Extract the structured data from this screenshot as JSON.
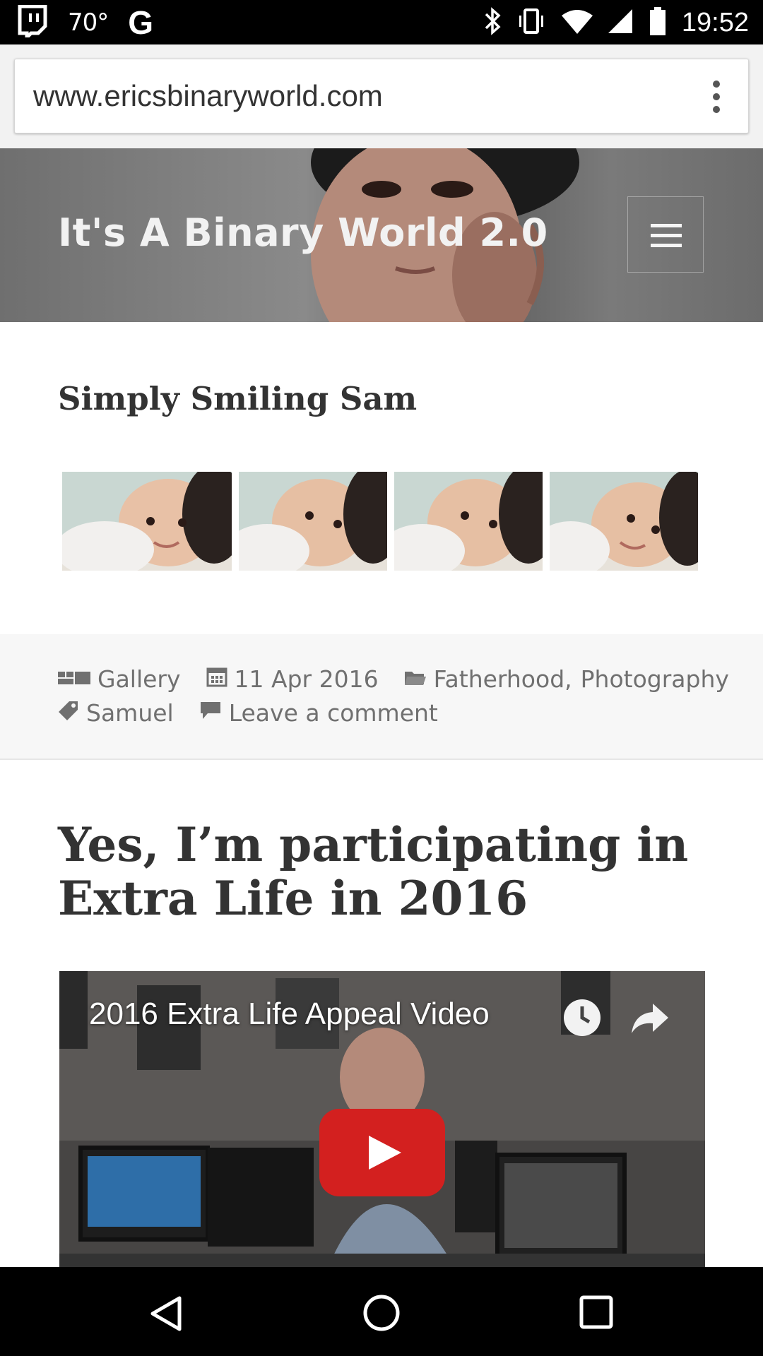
{
  "status_bar": {
    "temperature": "70°",
    "g_label": "G",
    "time": "19:52"
  },
  "browser": {
    "url": "www.ericsbinaryworld.com"
  },
  "site": {
    "title": "It's A Binary World 2.0"
  },
  "post1": {
    "title": "Simply Smiling Sam",
    "gallery_count": 4,
    "meta": {
      "format": "Gallery",
      "date": "11 Apr 2016",
      "category_1": "Fatherhood",
      "category_sep": ",",
      "category_2": "Photography",
      "tag": "Samuel",
      "comment_link": "Leave a comment"
    }
  },
  "post2": {
    "title": "Yes, I’m participating in Extra Life in 2016",
    "video_title": "2016 Extra Life Appeal Video"
  },
  "colors": {
    "status_bar_bg": "#000000",
    "youtube_red": "#d3201f",
    "meta_text": "#707070",
    "title_text": "#333333"
  }
}
